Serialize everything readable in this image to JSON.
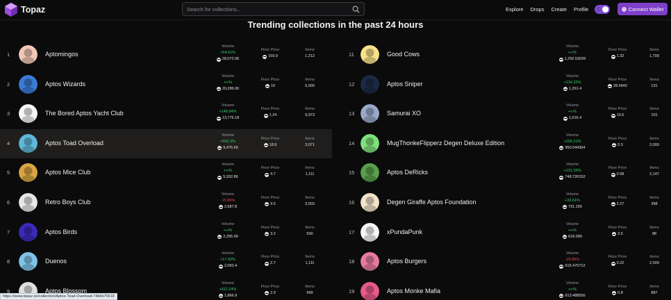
{
  "header": {
    "brand": "Topaz",
    "search_placeholder": "Search for collections...",
    "nav": [
      "Explore",
      "Drops",
      "Create",
      "Profile"
    ],
    "connect_label": "Connect Wallet"
  },
  "page_title": "Trending collections in the past 24 hours",
  "labels": {
    "volume": "Volume",
    "floor": "Floor Price",
    "items": "Items"
  },
  "left": [
    {
      "rank": "1",
      "name": "Aptomingos",
      "change": "+54.51%",
      "volume": "28,072.06",
      "floor": "169.9",
      "items": "1,212",
      "color": "#f1c7b5"
    },
    {
      "rank": "2",
      "name": "Aptos Wizards",
      "change": "+∞%",
      "volume": "20,286.06",
      "floor": "10",
      "items": "5,000",
      "color": "#3a7bd5"
    },
    {
      "rank": "3",
      "name": "The Bored Aptos Yacht Club",
      "change": "+148.84%",
      "volume": "13,776.18",
      "floor": "1.24",
      "items": "9,973",
      "color": "#f5f5f5"
    },
    {
      "rank": "4",
      "name": "Aptos Toad Overload",
      "change": "+563.3%",
      "volume": "9,475.69",
      "floor": "18.9",
      "items": "3,071",
      "color": "#5fb8d9"
    },
    {
      "rank": "5",
      "name": "Aptos Mice Club",
      "change": "+∞%",
      "volume": "5,932.86",
      "floor": "4.7",
      "items": "1,111",
      "color": "#d9a441"
    },
    {
      "rank": "6",
      "name": "Retro Boys Club",
      "change": "-15.86%",
      "volume": "2,687.8",
      "floor": "9.5",
      "items": "3,503",
      "color": "#e7e7e7"
    },
    {
      "rank": "7",
      "name": "Aptos Birds",
      "change": "+∞%",
      "volume": "2,295.99",
      "floor": "3.2",
      "items": "500",
      "color": "#3b2ab8"
    },
    {
      "rank": "8",
      "name": "Duenos",
      "change": "+17.42%",
      "volume": "2,050.4",
      "floor": "2.7",
      "items": "1,111",
      "color": "#7fc4e8"
    },
    {
      "rank": "9",
      "name": "Aptos Blossom",
      "change": "+511.24%",
      "volume": "1,866.9",
      "floor": "2.9",
      "items": "999",
      "color": "#e0e0e0"
    }
  ],
  "right": [
    {
      "rank": "11",
      "name": "Good Cows",
      "change": "+∞%",
      "volume": "1,292.53039",
      "floor": "1.32",
      "items": "1,700",
      "color": "#f7e28a"
    },
    {
      "rank": "12",
      "name": "Aptos Sniper",
      "change": "+134.33%",
      "volume": "1,261.4",
      "floor": "28.6942",
      "items": "131",
      "color": "#1a2a44"
    },
    {
      "rank": "13",
      "name": "Samurai XO",
      "change": "+∞%",
      "volume": "1,016.4",
      "floor": "10.5",
      "items": "101",
      "color": "#9aa8c9"
    },
    {
      "rank": "14",
      "name": "MugThonkeFlipperz Degen Deluxe Edition",
      "change": "+206.21%",
      "volume": "950.044304",
      "floor": "0.3",
      "items": "3,000",
      "color": "#7fe07a"
    },
    {
      "rank": "15",
      "name": "Aptos DeRicks",
      "change": "+131.26%",
      "volume": "748.726152",
      "floor": "0.58",
      "items": "2,147",
      "color": "#5aa04a"
    },
    {
      "rank": "16",
      "name": "Degen Giraffe Aptos Foundation",
      "change": "+33.61%",
      "volume": "731.156",
      "floor": "2.27",
      "items": "398",
      "color": "#f2e3c9"
    },
    {
      "rank": "17",
      "name": "xPundaPunk",
      "change": "+∞%",
      "volume": "618.099",
      "floor": "3.5",
      "items": "88",
      "color": "#f5f5f5"
    },
    {
      "rank": "18",
      "name": "Aptos Burgers",
      "change": "-29.86%",
      "volume": "615.470712",
      "floor": "0.22",
      "items": "2,500",
      "color": "#e87aa0"
    },
    {
      "rank": "19",
      "name": "Aptos Monke Mafia",
      "change": "+∞%",
      "volume": "613.488556",
      "floor": "0.8",
      "items": "887",
      "color": "#e85a8a"
    }
  ],
  "status_url": "https://www.topaz.so/collection/Aptos-Toad-Overload-74b6b76518"
}
